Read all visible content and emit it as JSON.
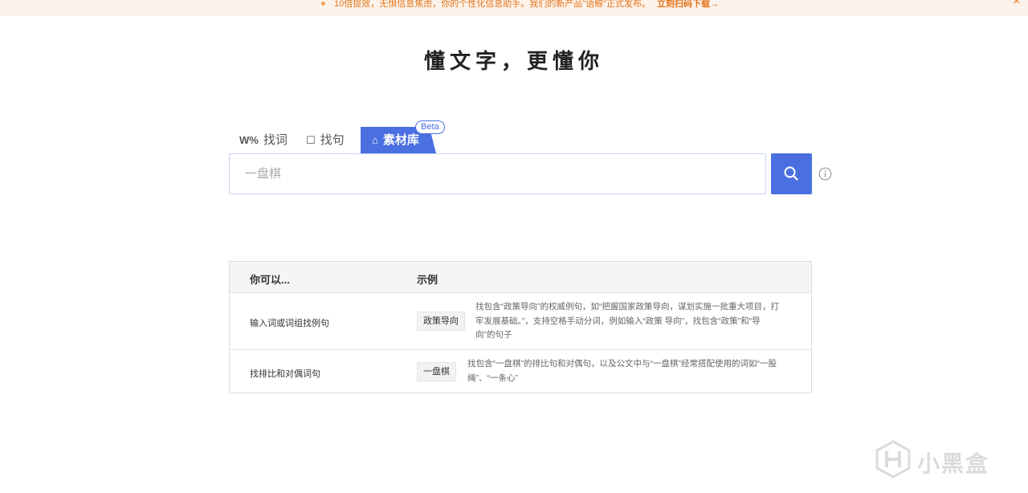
{
  "banner": {
    "message": "10倍提效，无惧信息焦虑，你的个性化信息助手。我们的新产品\"语鲸\"正式发布。",
    "cta": "立刻扫码下载→",
    "close": "×"
  },
  "slogan": "懂文字，更懂你",
  "tabs": [
    {
      "label": "找词",
      "icon": "W%"
    },
    {
      "label": "找句",
      "icon": "☐"
    },
    {
      "label": "素材库",
      "icon": "⌂"
    }
  ],
  "beta_badge": "Beta",
  "search": {
    "placeholder": "一盘棋"
  },
  "help_table": {
    "headers": [
      "你可以...",
      "示例"
    ],
    "rows": [
      {
        "label": "输入词或词组找例句",
        "example": "政策导向",
        "description": "找包含“政策导向”的权威例句，如“把握国家政策导向，谋划实施一批重大项目，打牢发展基础。”，支持空格手动分词，例如输入“政策 导向”，找包含“政策”和“导向”的句子"
      },
      {
        "label": "找排比和对偶词句",
        "example": "一盘棋",
        "description": "找包含“一盘棋”的排比句和对偶句，以及公文中与“一盘棋”经常搭配使用的词如“一股绳”、“一条心”"
      }
    ]
  },
  "watermark": "小黑盒",
  "colors": {
    "accent": "#4a6fe0",
    "banner_bg": "#fdf3ea",
    "banner_text": "#e2741a"
  }
}
